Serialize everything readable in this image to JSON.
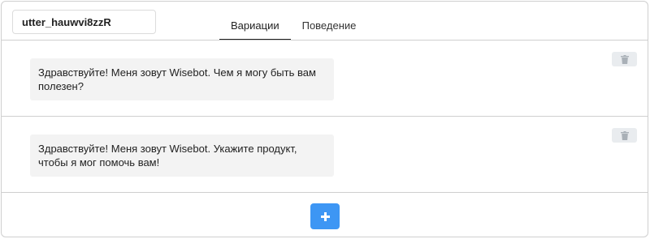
{
  "utterance": {
    "name_value": "utter_hauwvi8zzR"
  },
  "tabs": [
    {
      "label": "Вариации",
      "active": true
    },
    {
      "label": "Поведение",
      "active": false
    }
  ],
  "variations": [
    {
      "text": "Здравствуйте! Меня зовут Wisebot. Чем я могу быть вам полезен?"
    },
    {
      "text": "Здравствуйте! Меня зовут Wisebot. Укажите продукт, чтобы я мог помочь вам!"
    }
  ],
  "icons": {
    "delete": "trash-icon",
    "add": "plus-icon"
  },
  "colors": {
    "accent": "#3d96f4",
    "bubble_bg": "#f3f3f3",
    "delete_bg": "#e9ecef"
  }
}
